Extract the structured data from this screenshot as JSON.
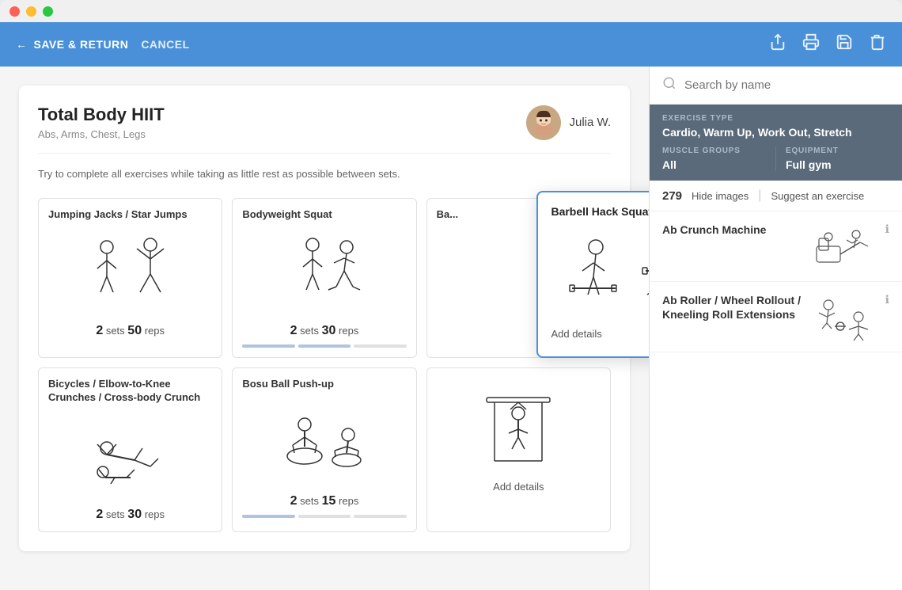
{
  "window": {
    "traffic_lights": [
      "red",
      "yellow",
      "green"
    ]
  },
  "toolbar": {
    "save_return_label": "SAVE & RETURN",
    "cancel_label": "CANCEL",
    "share_icon": "share",
    "print_icon": "print",
    "save_icon": "save",
    "delete_icon": "delete"
  },
  "workout": {
    "title": "Total Body HIIT",
    "tags": "Abs, Arms, Chest, Legs",
    "description": "Try to complete all exercises while taking as little rest as possible between sets.",
    "trainer_name": "Julia W.",
    "exercises": [
      {
        "name": "Jumping Jacks / Star Jumps",
        "sets": "2",
        "reps": "50",
        "sets_label": "sets",
        "reps_label": "reps"
      },
      {
        "name": "Bodyweight Squat",
        "sets": "2",
        "reps": "30",
        "sets_label": "sets",
        "reps_label": "reps"
      },
      {
        "name": "Ba... Hy...",
        "sets": "",
        "reps": "",
        "sets_label": "",
        "reps_label": ""
      },
      {
        "name": "Bicycles / Elbow-to-Knee Crunches / Cross-body Crunch",
        "sets": "2",
        "reps": "30",
        "sets_label": "sets",
        "reps_label": "reps"
      },
      {
        "name": "Bosu Ball Push-up",
        "sets": "2",
        "reps": "15",
        "sets_label": "sets",
        "reps_label": "reps"
      },
      {
        "name": "",
        "sets": "",
        "reps": "",
        "sets_label": "",
        "reps_label": ""
      }
    ],
    "hover_card": {
      "title": "Barbell Hack Squat",
      "add_details_label": "Add details"
    }
  },
  "search": {
    "placeholder": "Search by name"
  },
  "filters": {
    "exercise_type_label": "EXERCISE TYPE",
    "exercise_type_value": "Cardio, Warm Up, Work Out, Stretch",
    "muscle_groups_label": "MUSCLE GROUPS",
    "muscle_groups_value": "All",
    "equipment_label": "EQUIPMENT",
    "equipment_value": "Full gym"
  },
  "stats": {
    "count": "279",
    "hide_images_label": "Hide images",
    "suggest_label": "Suggest an exercise"
  },
  "exercise_list": [
    {
      "name": "Ab Crunch Machine",
      "has_info": true
    },
    {
      "name": "Ab Roller / Wheel Rollout / Kneeling Roll Extensions",
      "has_info": true
    }
  ]
}
